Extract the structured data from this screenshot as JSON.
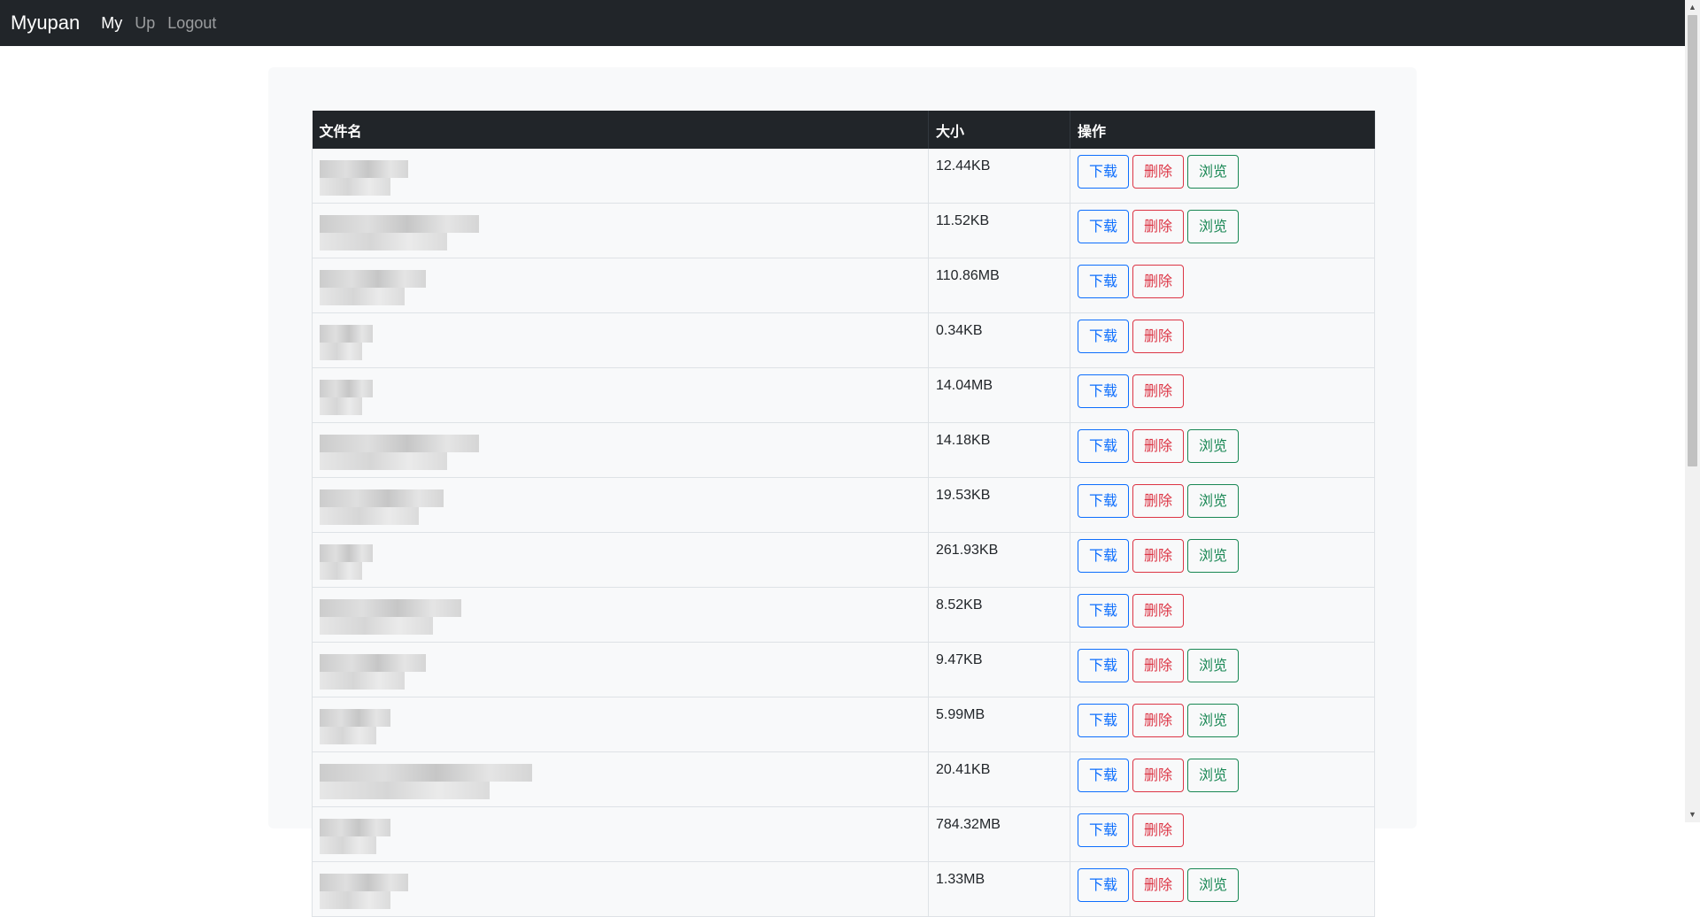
{
  "navbar": {
    "brand": "Myupan",
    "links": [
      {
        "label": "My",
        "active": true
      },
      {
        "label": "Up",
        "active": false
      },
      {
        "label": "Logout",
        "active": false
      }
    ]
  },
  "table": {
    "headers": {
      "name": "文件名",
      "size": "大小",
      "actions": "操作"
    },
    "buttons": {
      "download": "下载",
      "delete": "删除",
      "view": "浏览"
    },
    "rows": [
      {
        "name": "",
        "size": "12.44KB",
        "viewable": true
      },
      {
        "name": "",
        "size": "11.52KB",
        "viewable": true
      },
      {
        "name": "",
        "size": "110.86MB",
        "viewable": false
      },
      {
        "name": "",
        "size": "0.34KB",
        "viewable": false
      },
      {
        "name": "",
        "size": "14.04MB",
        "viewable": false
      },
      {
        "name": "",
        "size": "14.18KB",
        "viewable": true
      },
      {
        "name": "",
        "size": "19.53KB",
        "viewable": true
      },
      {
        "name": "",
        "size": "261.93KB",
        "viewable": true
      },
      {
        "name": "",
        "size": "8.52KB",
        "viewable": false
      },
      {
        "name": "",
        "size": "9.47KB",
        "viewable": true
      },
      {
        "name": "",
        "size": "5.99MB",
        "viewable": true
      },
      {
        "name": "",
        "size": "20.41KB",
        "viewable": true
      },
      {
        "name": "",
        "size": "784.32MB",
        "viewable": false
      },
      {
        "name": "",
        "size": "1.33MB",
        "viewable": true
      }
    ]
  },
  "colors": {
    "navbar_bg": "#212529",
    "download": "#0d6efd",
    "delete": "#dc3545",
    "view": "#198754"
  }
}
